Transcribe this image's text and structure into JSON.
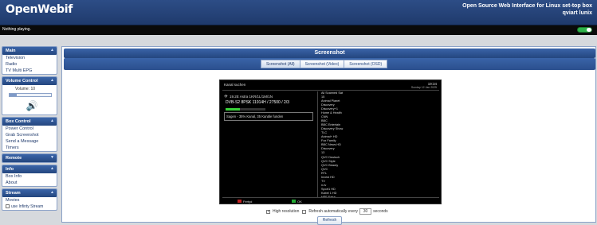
{
  "header": {
    "logo": "OpenWebif",
    "tagline": "Open Source Web Interface for Linux set-top box",
    "box_name": "qviart lunix"
  },
  "status": {
    "now_playing": "Nothing playing."
  },
  "sidebar": {
    "main": {
      "title": "Main",
      "items": [
        "Television",
        "Radio",
        "TV Multi EPG"
      ]
    },
    "volume": {
      "title": "Volume Control",
      "label": "Volume: 10",
      "level_percent": 10
    },
    "box_control": {
      "title": "Box Control",
      "items": [
        "Power Control",
        "Grab Screenshot",
        "Send a Message",
        "Timers"
      ]
    },
    "remote": {
      "title": "Remote"
    },
    "info": {
      "title": "Info",
      "items": [
        "Box Info",
        "About"
      ]
    },
    "stream": {
      "title": "Stream",
      "items": [
        "Movies"
      ],
      "checkbox_label": "use Infinty Stream"
    }
  },
  "main": {
    "title": "Screenshot",
    "tabs": [
      "Screenshot (All)",
      "Screenshot (Video)",
      "Screenshot (OSD)"
    ],
    "active_tab": 0
  },
  "screenshot": {
    "header_left": "Kanal suchen",
    "header_right": "19:34",
    "header_right_sub": "Sunday 12 Jan 2025",
    "channel_line": "19.2E  Astra 1KR/1L/1M/1N",
    "transponder": "DVB-S2  8PSK  11914H / 27500 / 2/3",
    "signal_text": "Sagen - 35% Kanal, 35 Kanäle funden",
    "signal_percent": 35,
    "satellites": [
      "All Scanned Sat",
      "15",
      "Animal Planet",
      "Discovery",
      "Discovery+1",
      "Home & Health",
      "CNN",
      "BBC",
      "BBC Entertain",
      "Discovery Show",
      "TLC",
      "Animal+ HD",
      "Fox Family",
      "BBC News HD",
      "Discovery",
      "13",
      "QVC Deutsch",
      "QVC Style",
      "QVC Beauty",
      "QVC",
      "RTL",
      "Invest HD",
      "TV",
      "n-tv",
      "Sport1 HD",
      "Kabel 1 HD",
      "HSE Extra"
    ],
    "legend_red": "Fertyd",
    "legend_green": "OK"
  },
  "options": {
    "high_resolution_label": "High resolution",
    "high_resolution_checked": true,
    "refresh_auto_label": "Refresh automatically every",
    "refresh_auto_checked": false,
    "seconds_value": "30",
    "seconds_label": "seconds",
    "refresh_button": "Refresh"
  }
}
